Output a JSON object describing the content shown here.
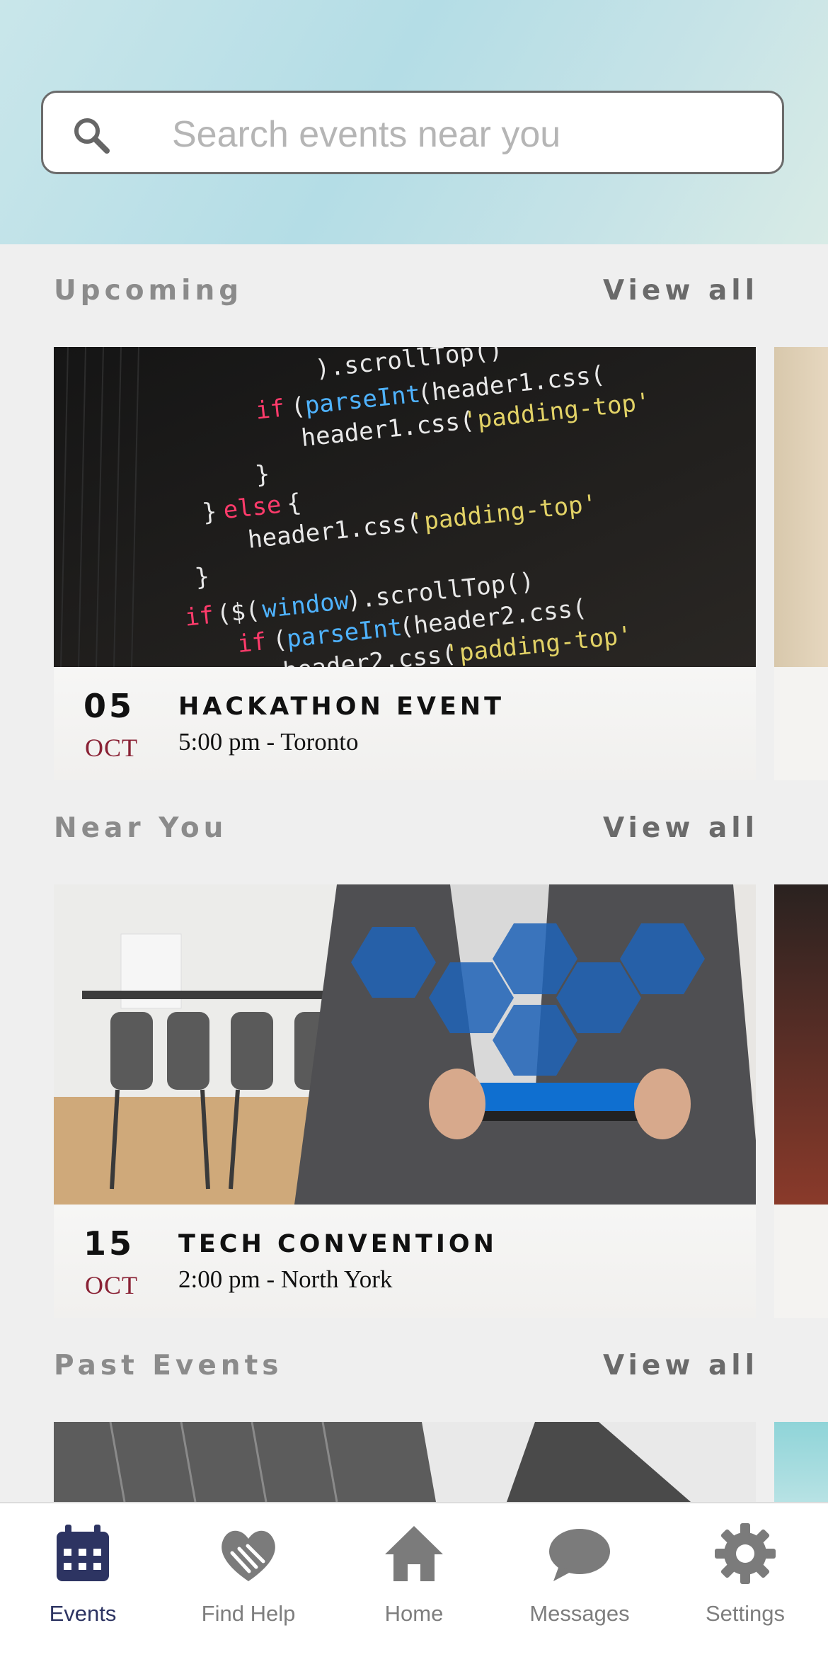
{
  "search": {
    "placeholder": "Search events near you",
    "icon": "search-icon"
  },
  "sections": {
    "upcoming": {
      "title": "Upcoming",
      "view_all": "View all",
      "card": {
        "day": "05",
        "month": "OCT",
        "title": "HACKATHON EVENT",
        "subtitle": "5:00 pm - Toronto"
      }
    },
    "near_you": {
      "title": "Near You",
      "view_all": "View all",
      "card": {
        "day": "15",
        "month": "OCT",
        "title": "TECH CONVENTION",
        "subtitle": "2:00 pm - North York"
      }
    },
    "past_events": {
      "title": "Past Events",
      "view_all": "View all"
    }
  },
  "tabbar": {
    "items": [
      {
        "label": "Events",
        "icon": "calendar-icon",
        "active": true
      },
      {
        "label": "Find Help",
        "icon": "heart-hands-icon",
        "active": false
      },
      {
        "label": "Home",
        "icon": "home-icon",
        "active": false
      },
      {
        "label": "Messages",
        "icon": "chat-bubble-icon",
        "active": false
      },
      {
        "label": "Settings",
        "icon": "gear-icon",
        "active": false
      }
    ]
  },
  "colors": {
    "accent": "#2d3462",
    "month": "#8a2235",
    "muted_text": "#7e7e7e"
  }
}
